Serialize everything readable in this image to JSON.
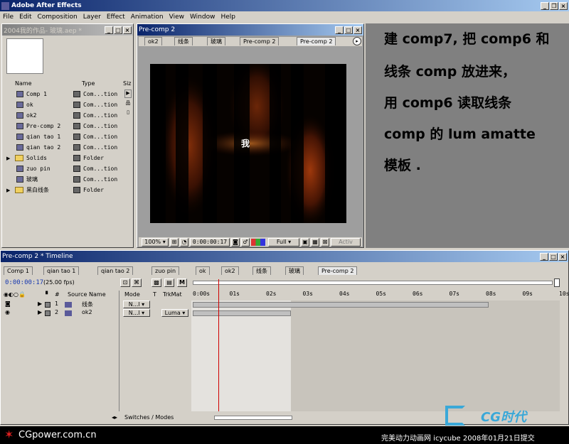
{
  "app": {
    "title": "Adobe After Effects",
    "menus": [
      "File",
      "Edit",
      "Composition",
      "Layer",
      "Effect",
      "Animation",
      "View",
      "Window",
      "Help"
    ]
  },
  "project": {
    "title": "2004我的作品- 玻璃.aep *",
    "col_name": "Name",
    "col_type": "Type",
    "col_size": "Siz",
    "items": [
      {
        "name": "Comp 1",
        "type": "Com...tion",
        "kind": "comp"
      },
      {
        "name": "ok",
        "type": "Com...tion",
        "kind": "comp"
      },
      {
        "name": "ok2",
        "type": "Com...tion",
        "kind": "comp"
      },
      {
        "name": "Pre-comp 2",
        "type": "Com...tion",
        "kind": "comp"
      },
      {
        "name": "qian tao 1",
        "type": "Com...tion",
        "kind": "comp"
      },
      {
        "name": "qian tao 2",
        "type": "Com...tion",
        "kind": "comp"
      },
      {
        "name": "Solids",
        "type": "Folder",
        "kind": "folder"
      },
      {
        "name": "zuo pin",
        "type": "Com...tion",
        "kind": "comp"
      },
      {
        "name": "玻璃",
        "type": "Com...tion",
        "kind": "comp"
      },
      {
        "name": "黑白线条",
        "type": "Folder",
        "kind": "folder"
      }
    ]
  },
  "comp_window": {
    "title": "Pre-comp 2",
    "tabs": [
      "ok2",
      "线条",
      "玻璃",
      "Pre-comp 2",
      "Pre-comp 2"
    ],
    "frame_text": "我",
    "zoom": "100%",
    "timecode": "0:00:00:17",
    "resolution": "Full",
    "active_label": "Activ"
  },
  "annotation": {
    "lines": [
      "建 comp7, 把 comp6 和",
      "线条 comp 放进来，",
      "用 comp6 读取线条",
      "comp 的 lum amatte",
      "模板 ."
    ]
  },
  "timeline": {
    "title": "Pre-comp 2 * Timeline",
    "tabs": [
      "Comp 1",
      "qian tao 1",
      "qian tao 2",
      "zuo pin",
      "ok",
      "ok2",
      "线条",
      "玻璃",
      "Pre-comp 2"
    ],
    "timecode": "0:00:00:17",
    "fps": "(25.00 fps)",
    "headers": {
      "num": "#",
      "source": "Source Name",
      "mode": "Mode",
      "t": "T",
      "trkmat": "TrkMat"
    },
    "ruler": [
      "0:00s",
      "01s",
      "02s",
      "03s",
      "04s",
      "05s",
      "06s",
      "07s",
      "08s",
      "09s",
      "10s"
    ],
    "layers": [
      {
        "num": "1",
        "name": "线条",
        "mode": "N...l",
        "trkmat": ""
      },
      {
        "num": "2",
        "name": "ok2",
        "mode": "N...l",
        "trkmat": "Luma"
      }
    ],
    "switches_label": "Switches / Modes"
  },
  "footer": {
    "left": "CGpower.com.cn",
    "right": "完美动力动画网 icycube 2008年01月21日提交",
    "logo": "CG时代"
  }
}
